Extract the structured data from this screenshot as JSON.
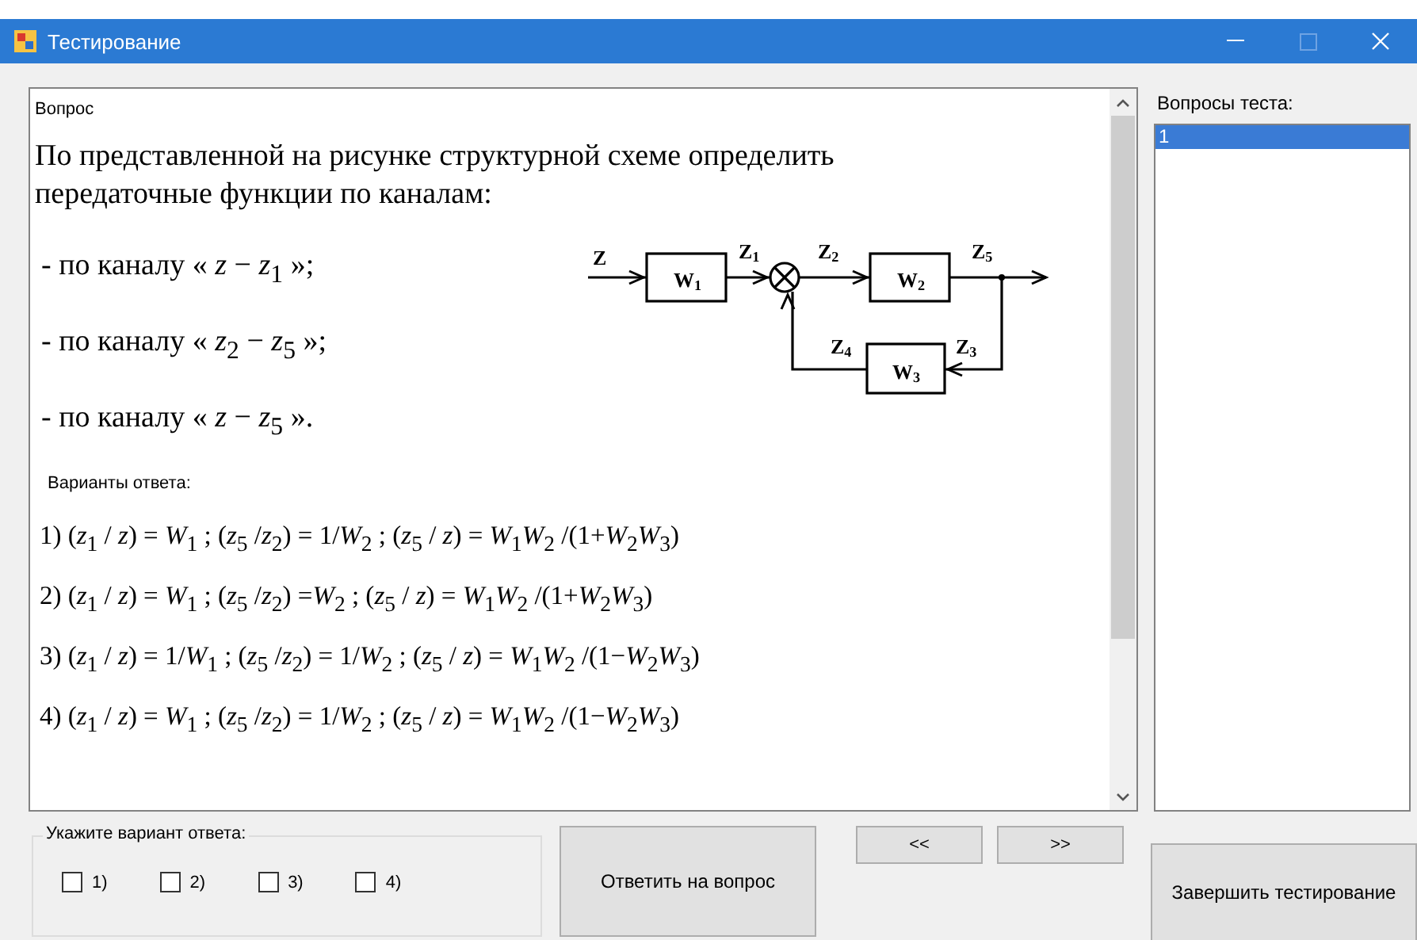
{
  "window": {
    "title": "Тестирование"
  },
  "question": {
    "label": "Вопрос",
    "text": "По представленной на рисунке структурной схеме определить передаточные функции по каналам:",
    "channels": [
      "- по каналу « *z* − *z*$_{1}$ »;",
      "- по каналу « *z*$_{2}$ − *z*$_{5}$ »;",
      "- по каналу « *z* − *z*$_{5}$ »."
    ],
    "diagram": {
      "blocks": [
        {
          "text": "W",
          "sub": "1"
        },
        {
          "text": "W",
          "sub": "2"
        },
        {
          "text": "W",
          "sub": "3"
        }
      ],
      "signals": [
        {
          "text": "Z"
        },
        {
          "text": "Z",
          "sub": "1"
        },
        {
          "text": "Z",
          "sub": "2"
        },
        {
          "text": "Z",
          "sub": "5"
        },
        {
          "text": "Z",
          "sub": "4"
        },
        {
          "text": "Z",
          "sub": "3"
        }
      ]
    },
    "answers_label": "Варианты ответа:",
    "answers": [
      "1) (*z*$_{1}$ / *z*) = *W*$_{1}$ ;  (*z*$_{5}$ /*z*$_{2}$) = 1/*W*$_{2}$ ;  (*z*$_{5}$ / *z*) = *W*$_{1}$*W*$_{2}$ /(1+*W*$_{2}$*W*$_{3}$)",
      "2) (*z*$_{1}$ / *z*) = *W*$_{1}$ ;  (*z*$_{5}$ /*z*$_{2}$) =*W*$_{2}$ ;  (*z*$_{5}$ / *z*) = *W*$_{1}$*W*$_{2}$ /(1+*W*$_{2}$*W*$_{3}$)",
      "3) (*z*$_{1}$ / *z*) = 1/*W*$_{1}$ ;  (*z*$_{5}$ /*z*$_{2}$) = 1/*W*$_{2}$ ;  (*z*$_{5}$ / *z*) = *W*$_{1}$*W*$_{2}$ /(1−*W*$_{2}$*W*$_{3}$)",
      "4) (*z*$_{1}$ / *z*) = *W*$_{1}$ ;  (*z*$_{5}$ /*z*$_{2}$) = 1/*W*$_{2}$ ;  (*z*$_{5}$ / *z*) = *W*$_{1}$*W*$_{2}$ /(1−*W*$_{2}$*W*$_{3}$)"
    ]
  },
  "question_list": {
    "label": "Вопросы теста:",
    "items": [
      {
        "text": "1",
        "selected": true
      }
    ]
  },
  "answer_group": {
    "label": "Укажите вариант ответа:",
    "options": [
      {
        "label": "1)",
        "checked": false
      },
      {
        "label": "2)",
        "checked": false
      },
      {
        "label": "3)",
        "checked": false
      },
      {
        "label": "4)",
        "checked": false
      }
    ]
  },
  "buttons": {
    "answer": "Ответить на вопрос",
    "prev": "<<",
    "next": ">>",
    "finish": "Завершить тестирование"
  }
}
